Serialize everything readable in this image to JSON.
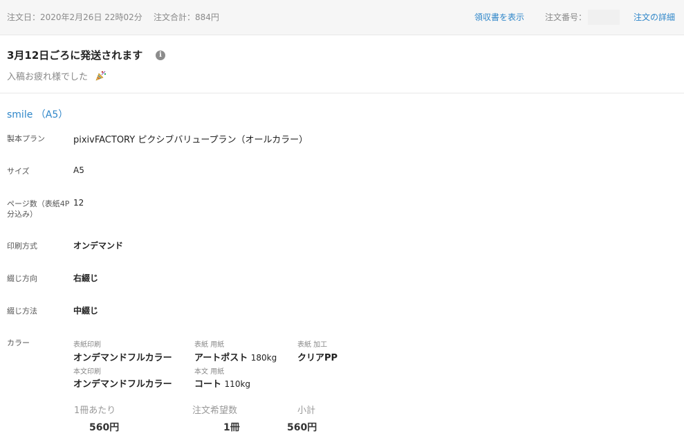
{
  "header": {
    "order_date": "注文日：2020年2月26日 22時02分",
    "order_total": "注文合計：884円",
    "receipt_link": "領収書を表示",
    "order_number_label": "注文番号：",
    "order_detail_link": "注文の詳細"
  },
  "shipping": {
    "message": "3月12日ごろに発送されます",
    "info_icon": "info-icon",
    "note": "入稿お疲れ様でした"
  },
  "item": {
    "title": "smile （A5）",
    "specs": [
      {
        "label": "製本プラン",
        "value": "pixivFACTORY ピクシブバリュープラン（オールカラー）"
      },
      {
        "label": "サイズ",
        "value": "A5"
      },
      {
        "label": "ページ数（表紙4P分込み）",
        "value": "12"
      },
      {
        "label": "印刷方式",
        "value": "オンデマンド"
      },
      {
        "label": "綴じ方向",
        "value": "右綴じ"
      },
      {
        "label": "綴じ方法",
        "value": "中綴じ"
      }
    ],
    "color": {
      "label": "カラー",
      "cover_print_label": "表紙印刷",
      "cover_print_value": "オンデマンドフルカラー",
      "cover_paper_label": "表紙 用紙",
      "cover_paper_value": "アートポスト",
      "cover_paper_weight": "180kg",
      "cover_finish_label": "表紙 加工",
      "cover_finish_value": "クリアPP",
      "body_print_label": "本文印刷",
      "body_print_value": "オンデマンドフルカラー",
      "body_paper_label": "本文 用紙",
      "body_paper_value": "コート",
      "body_paper_weight": "110kg"
    },
    "summary": {
      "unit_label": "1冊あたり",
      "unit_value": "560円",
      "qty_label": "注文希望数",
      "qty_value": "1冊",
      "subtotal_label": "小計",
      "subtotal_value": "560円"
    }
  }
}
